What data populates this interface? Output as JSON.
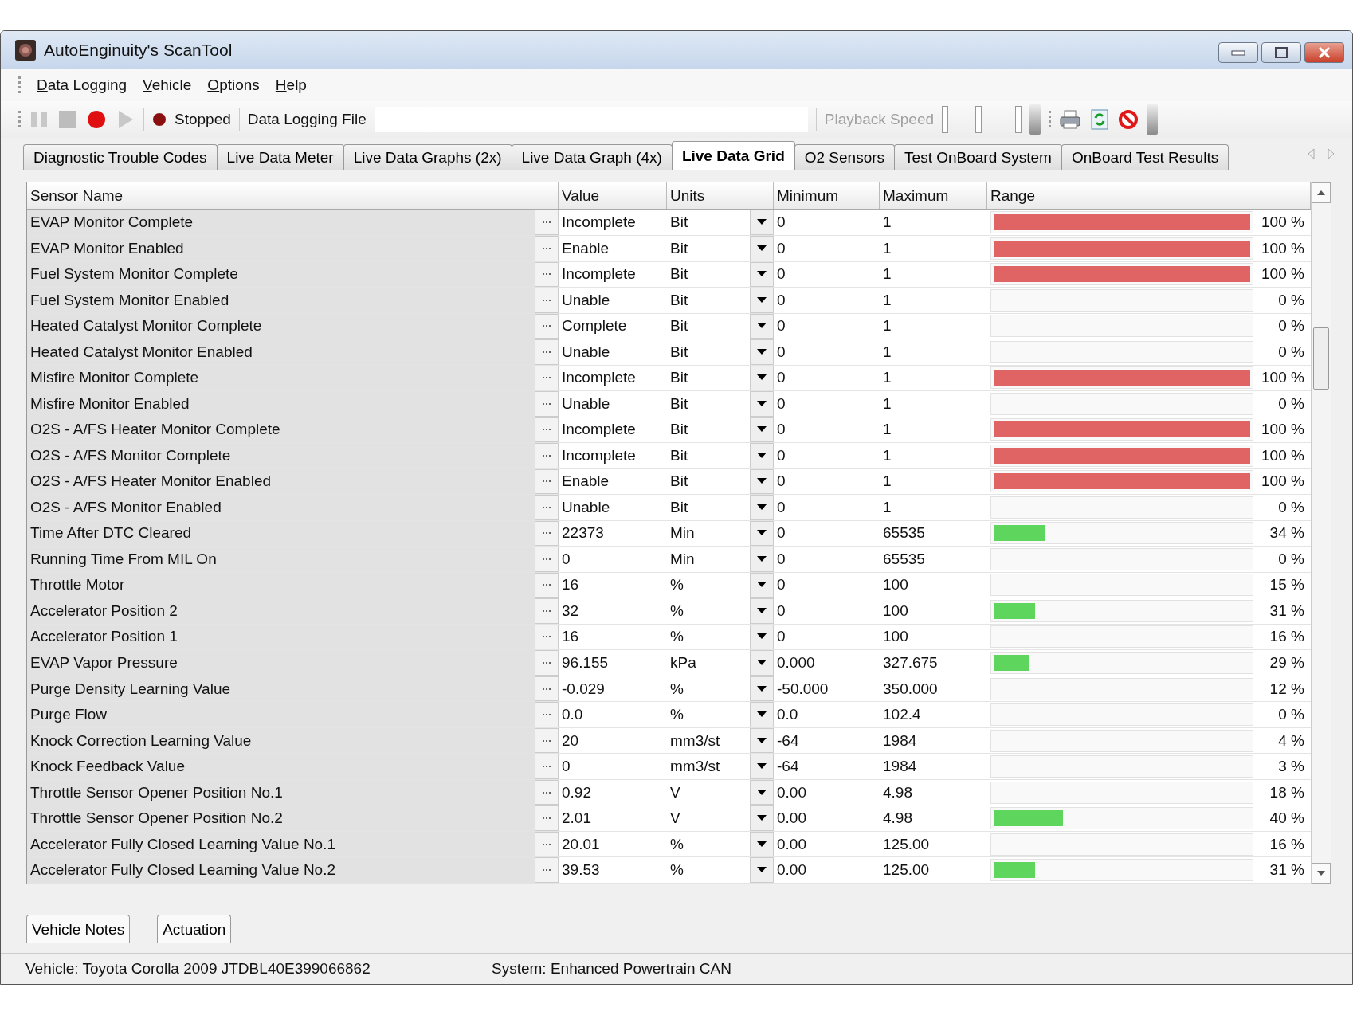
{
  "window": {
    "title": "AutoEnginuity's ScanTool"
  },
  "menu": [
    {
      "label": "Data Logging"
    },
    {
      "label": "Vehicle"
    },
    {
      "label": "Options"
    },
    {
      "label": "Help"
    }
  ],
  "toolbar": {
    "status": "Stopped",
    "file_label": "Data Logging File",
    "playback": {
      "label": "Playback Speed",
      "disabled": true,
      "level": 1
    }
  },
  "tabs": [
    {
      "label": "Diagnostic Trouble Codes",
      "selected": false
    },
    {
      "label": "Live Data Meter",
      "selected": false
    },
    {
      "label": "Live Data Graphs (2x)",
      "selected": false
    },
    {
      "label": "Live Data Graph (4x)",
      "selected": false
    },
    {
      "label": "Live Data Grid",
      "selected": true
    },
    {
      "label": "O2 Sensors",
      "selected": false
    },
    {
      "label": "Test OnBoard System",
      "selected": false
    },
    {
      "label": "OnBoard Test Results",
      "selected": false
    }
  ],
  "grid": {
    "columns": [
      "Sensor Name",
      "Value",
      "Units",
      "Minimum",
      "Maximum",
      "Range"
    ],
    "rows": [
      {
        "sensor": "EVAP Monitor Complete",
        "value": "Incomplete",
        "units": "Bit",
        "minimum": "0",
        "maximum": "1",
        "reading": "100 %",
        "level": 1,
        "color": "#e06464"
      },
      {
        "sensor": "EVAP Monitor Enabled",
        "value": "Enable",
        "units": "Bit",
        "minimum": "0",
        "maximum": "1",
        "reading": "100 %",
        "level": 1,
        "color": "#e06464"
      },
      {
        "sensor": "Fuel System Monitor Complete",
        "value": "Incomplete",
        "units": "Bit",
        "minimum": "0",
        "maximum": "1",
        "reading": "100 %",
        "level": 1,
        "color": "#e06464"
      },
      {
        "sensor": "Fuel System Monitor Enabled",
        "value": "Unable",
        "units": "Bit",
        "minimum": "0",
        "maximum": "1",
        "reading": "0 %"
      },
      {
        "sensor": "Heated Catalyst Monitor Complete",
        "value": "Complete",
        "units": "Bit",
        "minimum": "0",
        "maximum": "1",
        "reading": "0 %"
      },
      {
        "sensor": "Heated Catalyst Monitor Enabled",
        "value": "Unable",
        "units": "Bit",
        "minimum": "0",
        "maximum": "1",
        "reading": "0 %"
      },
      {
        "sensor": "Misfire Monitor Complete",
        "value": "Incomplete",
        "units": "Bit",
        "minimum": "0",
        "maximum": "1",
        "reading": "100 %",
        "level": 1,
        "color": "#e06464"
      },
      {
        "sensor": "Misfire Monitor Enabled",
        "value": "Unable",
        "units": "Bit",
        "minimum": "0",
        "maximum": "1",
        "reading": "0 %"
      },
      {
        "sensor": "O2S - A/FS Heater Monitor Complete",
        "value": "Incomplete",
        "units": "Bit",
        "minimum": "0",
        "maximum": "1",
        "reading": "100 %",
        "level": 1,
        "color": "#e06464"
      },
      {
        "sensor": "O2S - A/FS Monitor Complete",
        "value": "Incomplete",
        "units": "Bit",
        "minimum": "0",
        "maximum": "1",
        "reading": "100 %",
        "level": 1,
        "color": "#e06464"
      },
      {
        "sensor": "O2S - A/FS Heater Monitor Enabled",
        "value": "Enable",
        "units": "Bit",
        "minimum": "0",
        "maximum": "1",
        "reading": "100 %",
        "level": 1,
        "color": "#e06464"
      },
      {
        "sensor": "O2S - A/FS Monitor Enabled",
        "value": "Unable",
        "units": "Bit",
        "minimum": "0",
        "maximum": "1",
        "reading": "0 %"
      },
      {
        "sensor": "Time After DTC Cleared",
        "value": "22373",
        "units": "Min",
        "minimum": "0",
        "maximum": "65535",
        "reading": "34 %",
        "level": 0.2,
        "color": "#5ed65e"
      },
      {
        "sensor": "Running Time From MIL On",
        "value": "0",
        "units": "Min",
        "minimum": "0",
        "maximum": "65535",
        "reading": "0 %"
      },
      {
        "sensor": "Throttle Motor",
        "value": "16",
        "units": "%",
        "minimum": "0",
        "maximum": "100",
        "reading": "15 %"
      },
      {
        "sensor": "Accelerator Position 2",
        "value": "32",
        "units": "%",
        "minimum": "0",
        "maximum": "100",
        "reading": "31 %",
        "level": 0.16,
        "color": "#5ed65e"
      },
      {
        "sensor": "Accelerator Position 1",
        "value": "16",
        "units": "%",
        "minimum": "0",
        "maximum": "100",
        "reading": "16 %"
      },
      {
        "sensor": "EVAP Vapor Pressure",
        "value": "96.155",
        "units": "kPa",
        "minimum": "0.000",
        "maximum": "327.675",
        "reading": "29 %",
        "level": 0.14,
        "color": "#5ed65e"
      },
      {
        "sensor": "Purge Density Learning Value",
        "value": "-0.029",
        "units": "%",
        "minimum": "-50.000",
        "maximum": "350.000",
        "reading": "12 %"
      },
      {
        "sensor": "Purge Flow",
        "value": "0.0",
        "units": "%",
        "minimum": "0.0",
        "maximum": "102.4",
        "reading": "0 %"
      },
      {
        "sensor": "Knock Correction Learning Value",
        "value": "20",
        "units": "mm3/st",
        "minimum": "-64",
        "maximum": "1984",
        "reading": "4 %"
      },
      {
        "sensor": "Knock Feedback Value",
        "value": "0",
        "units": "mm3/st",
        "minimum": "-64",
        "maximum": "1984",
        "reading": "3 %"
      },
      {
        "sensor": "Throttle Sensor Opener Position No.1",
        "value": "0.92",
        "units": "V",
        "minimum": "0.00",
        "maximum": "4.98",
        "reading": "18 %"
      },
      {
        "sensor": "Throttle Sensor Opener Position No.2",
        "value": "2.01",
        "units": "V",
        "minimum": "0.00",
        "maximum": "4.98",
        "reading": "40 %",
        "level": 0.27,
        "color": "#5ed65e"
      },
      {
        "sensor": "Accelerator Fully Closed Learning Value No.1",
        "value": "20.01",
        "units": "%",
        "minimum": "0.00",
        "maximum": "125.00",
        "reading": "16 %"
      },
      {
        "sensor": "Accelerator Fully Closed Learning Value No.2",
        "value": "39.53",
        "units": "%",
        "minimum": "0.00",
        "maximum": "125.00",
        "reading": "31 %",
        "level": 0.16,
        "color": "#5ed65e"
      }
    ]
  },
  "bottom_tabs": [
    "Vehicle Notes",
    "Actuation"
  ],
  "status_bar": [
    "Vehicle: Toyota  Corolla  2009  JTDBL40E399066862",
    "System: Enhanced Powertrain CAN"
  ]
}
